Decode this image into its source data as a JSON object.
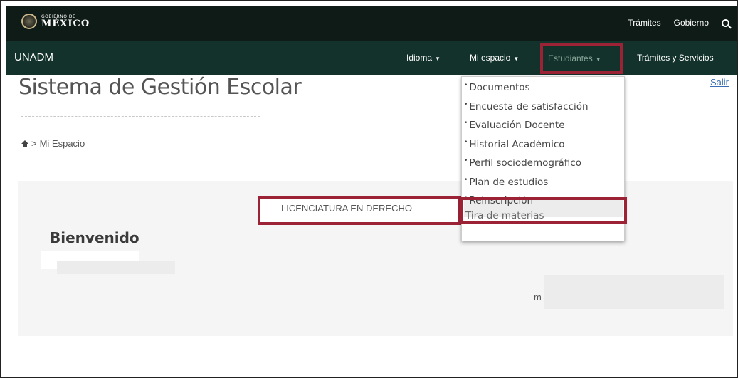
{
  "gov": {
    "logo_small": "GOBIERNO DE",
    "logo_big": "MÉXICO",
    "links": [
      "Trámites",
      "Gobierno"
    ]
  },
  "nav": {
    "brand": "UNADM",
    "items": [
      {
        "label": "Idioma"
      },
      {
        "label": "Mi espacio"
      },
      {
        "label": "Estudiantes"
      },
      {
        "label": "Trámites y Servicios"
      }
    ]
  },
  "page": {
    "title": "Sistema de Gestión Escolar",
    "logout": "Salir",
    "breadcrumb": "Mi Espacio",
    "breadcrumb_sep": ">",
    "program": "LICENCIATURA EN DERECHO",
    "welcome": "Bienvenido",
    "partial_text": "m"
  },
  "dropdown": {
    "items": [
      "Documentos",
      "Encuesta de satisfacción",
      "Evaluación Docente",
      "Historial Académico",
      "Perfil sociodemográfico",
      "Plan de estudios",
      "Reinscripción",
      "Tira de materias"
    ],
    "bullet": "•"
  },
  "colors": {
    "gov_bar": "#0f1b17",
    "navbar": "#13322b",
    "highlight": "#9b2335"
  }
}
